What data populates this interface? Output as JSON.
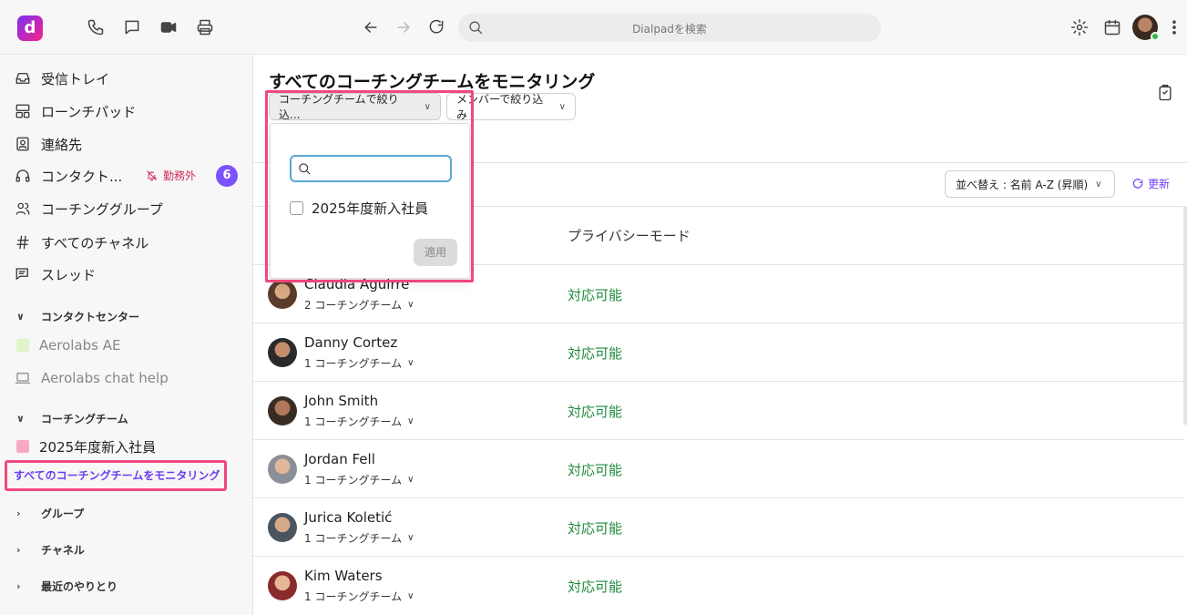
{
  "topbar": {
    "logo_letter": "d",
    "search_placeholder": "Dialpadを検索",
    "icons": [
      "phone-icon",
      "chat-icon",
      "video-icon",
      "print-icon",
      "back-icon",
      "forward-icon",
      "reload-icon",
      "gear-icon",
      "calendar-icon",
      "more-icon"
    ]
  },
  "sidebar": {
    "items": [
      {
        "label": "受信トレイ",
        "icon": "inbox-icon"
      },
      {
        "label": "ローンチパッド",
        "icon": "launchpad-icon"
      },
      {
        "label": "連絡先",
        "icon": "contacts-icon"
      },
      {
        "label": "コンタクト...",
        "icon": "headset-icon"
      },
      {
        "label": "コーチンググループ",
        "icon": "people-icon"
      },
      {
        "label": "すべてのチャネル",
        "icon": "hash-icon"
      },
      {
        "label": "スレッド",
        "icon": "thread-icon"
      }
    ],
    "contact_status": "勤務外",
    "contact_badge": "6",
    "section_contact_center": "コンタクトセンター",
    "contact_centers": [
      {
        "label": "Aerolabs AE",
        "color": "#dff5c8"
      },
      {
        "label": "Aerolabs chat help"
      }
    ],
    "section_coaching_team": "コーチングチーム",
    "coaching_team": {
      "label": "2025年度新入社員",
      "color": "#f7a9c4"
    },
    "monitor_all": "すべてのコーチングチームをモニタリング",
    "groups": "グループ",
    "channels": "チャネル",
    "recent": "最近のやりとり"
  },
  "main": {
    "title": "すべてのコーチングチームをモニタリング",
    "filter_team": "コーチングチームで絞り込...",
    "filter_member": "メンバーで絞り込み",
    "sort": "並べ替え : 名前 A-Z (昇順)",
    "refresh": "更新",
    "col_privacy": "プライバシーモード",
    "rows": [
      {
        "name": "Claudia Aguirre",
        "teams": "2 コーチングチーム",
        "status": "対応可能"
      },
      {
        "name": "Danny Cortez",
        "teams": "1 コーチングチーム",
        "status": "対応可能"
      },
      {
        "name": "John Smith",
        "teams": "1 コーチングチーム",
        "status": "対応可能"
      },
      {
        "name": "Jordan Fell",
        "teams": "1 コーチングチーム",
        "status": "対応可能"
      },
      {
        "name": "Jurica Koletić",
        "teams": "1 コーチングチーム",
        "status": "対応可能"
      },
      {
        "name": "Kim Waters",
        "teams": "1 コーチングチーム",
        "status": "対応可能"
      }
    ]
  },
  "dropdown": {
    "search_value": "",
    "option": "2025年度新入社員",
    "option_checked": false,
    "apply": "適用"
  },
  "colors": {
    "accent": "#6c3cf0",
    "highlight": "#f0487d",
    "available": "#1f8a3c",
    "badge": "#7c52ff"
  }
}
